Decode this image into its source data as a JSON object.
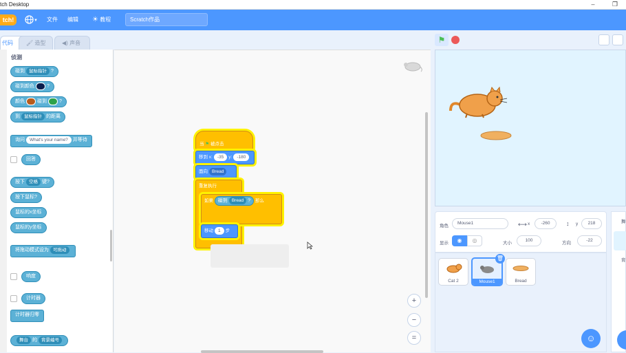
{
  "window": {
    "title": "tch Desktop",
    "minimize": "–",
    "maximize": "❐"
  },
  "menu": {
    "logo": "tch!",
    "file": "文件",
    "edit": "编辑",
    "tutorials": "教程",
    "project_title": "Scratch作品"
  },
  "tabs": {
    "code": "代码",
    "costumes": "造型",
    "sounds": "声音"
  },
  "palette": {
    "category": "侦测",
    "touching_prefix": "碰到",
    "touching_option": "鼠标指针",
    "q": "?",
    "touching_color": "碰到颜色",
    "color": "颜色",
    "color_touching": "碰到",
    "distance_prefix": "到",
    "distance_option": "鼠标指针",
    "distance_suffix": "的距离",
    "ask_prefix": "询问",
    "ask_value": "What's your name?",
    "ask_suffix": "并等待",
    "answer": "回答",
    "key_pressed_prefix": "按下",
    "key_option": "空格",
    "key_suffix": "键?",
    "mouse_down": "按下鼠标?",
    "mouse_x": "鼠标的x坐标",
    "mouse_y": "鼠标的y坐标",
    "drag_mode_prefix": "将拖动模式设为",
    "drag_mode_option": "可拖动",
    "loudness": "响度",
    "timer": "计时器",
    "reset_timer": "计时器归零",
    "of_option": "舞台",
    "of_mid": "的",
    "of_attr": "背景编号"
  },
  "script": {
    "when_flag_prefix": "当",
    "when_flag_suffix": "被点击",
    "goto_prefix": "移到 x:",
    "goto_x": "-35",
    "goto_y_label": "y:",
    "goto_y": "-180",
    "point_prefix": "面向",
    "point_option": "Bread",
    "forever": "重复执行",
    "if_prefix": "如果",
    "if_touching": "碰到",
    "if_option": "Bread",
    "if_q": "?",
    "if_then": "那么",
    "move_prefix": "移动",
    "move_steps": "1",
    "move_suffix": "步"
  },
  "zoom": {
    "in": "+",
    "out": "−",
    "reset": "="
  },
  "sprite_info": {
    "sprite_label": "角色",
    "sprite_name": "Mouse1",
    "x_label": "x",
    "x_value": "-260",
    "y_label": "y",
    "y_value": "218",
    "show_label": "显示",
    "size_label": "大小",
    "size_value": "100",
    "direction_label": "方向",
    "direction_value": "-22"
  },
  "sprites": [
    {
      "name": "Cat 2"
    },
    {
      "name": "Mouse1"
    },
    {
      "name": "Bread"
    }
  ],
  "stage_side": {
    "label": "舞",
    "backdrop": "背"
  },
  "colors": {
    "menu": "#4c97ff",
    "sensing": "#5cb1d6",
    "events": "#ffbf00",
    "motion": "#4c97ff",
    "stage": "#e1f4ff"
  }
}
